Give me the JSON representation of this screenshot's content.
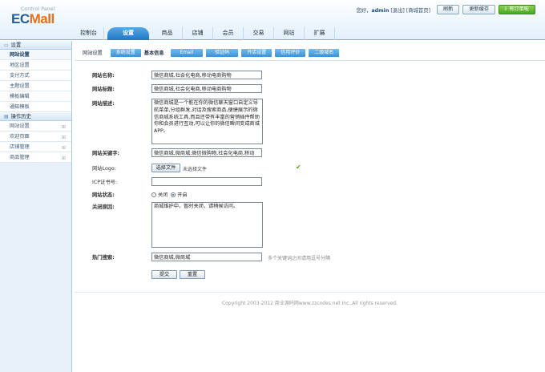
{
  "logo": {
    "cp": "Control Panel",
    "ec": "EC",
    "mall": "Mall"
  },
  "topbar": {
    "welcome_prefix": "您好，",
    "user": "admin",
    "logout": "[退出]",
    "home": "[商城首页]",
    "refresh": "刷新",
    "clear_cache": "更新缓存",
    "order_tip": "有订单啦"
  },
  "nav": {
    "items": [
      "控制台",
      "设置",
      "商品",
      "店铺",
      "会员",
      "交易",
      "网站",
      "扩展"
    ],
    "active": 1
  },
  "sidebar": {
    "group1": "设置",
    "items1": [
      "网站设置",
      "地区设置",
      "支付方式",
      "主题设置",
      "模板编辑",
      "通知模板"
    ],
    "group2": "操作历史",
    "items2": [
      "网站设置",
      "欢迎页面",
      "店铺管理",
      "商品管理"
    ]
  },
  "tabs": {
    "label": "网站设置",
    "system": "系统设置",
    "basic": "基本信息",
    "email": "Email",
    "captcha": "验证码",
    "store": "开店设置",
    "credit": "信用评价",
    "domain": "二级域名"
  },
  "form": {
    "site_name_label": "网站名称:",
    "site_name": "微信商城,社会化电商,移动电商购物",
    "site_title_label": "网站标题:",
    "site_title": "微信商城,社会化电商,移动电商购物",
    "site_desc_label": "网站描述:",
    "site_desc": "微信商城是一个能在你的微信聊天窗口自定义导航菜单,分组群发,对话及搜索商品,便捷展示的微信商城系统工具,而且还带有丰富的营销插件帮助你和会员进行互动,可以让你的微信瞬间变成商城APP。",
    "site_keywords_label": "网站关键字:",
    "site_keywords": "微信商城,微商城,微信微购物,社会化电商,移动",
    "site_logo_label": "网站Logo:",
    "choose_file": "选择文件",
    "no_file": "未选择文件",
    "icp_label": "ICP证书号:",
    "icp": "",
    "status_label": "网站状态:",
    "status_off": "关闭",
    "status_on": "开启",
    "close_reason_label": "关闭原因:",
    "close_reason": "商城维护中，暂时关闭，请稍候访问。",
    "hot_search_label": "热门搜索:",
    "hot_search": "微信商城,微商城",
    "hot_search_hint": "多个关键词之间请用逗号分隔",
    "submit": "提交",
    "reset": "重置"
  },
  "footer": "Copyright 2003-2012 商业源码网www.zzcodes.net Inc.,All rights reserved.",
  "colors": {
    "accent": "#1f78c4",
    "tab": "#3b92d6",
    "ok": "#4aa51f"
  }
}
